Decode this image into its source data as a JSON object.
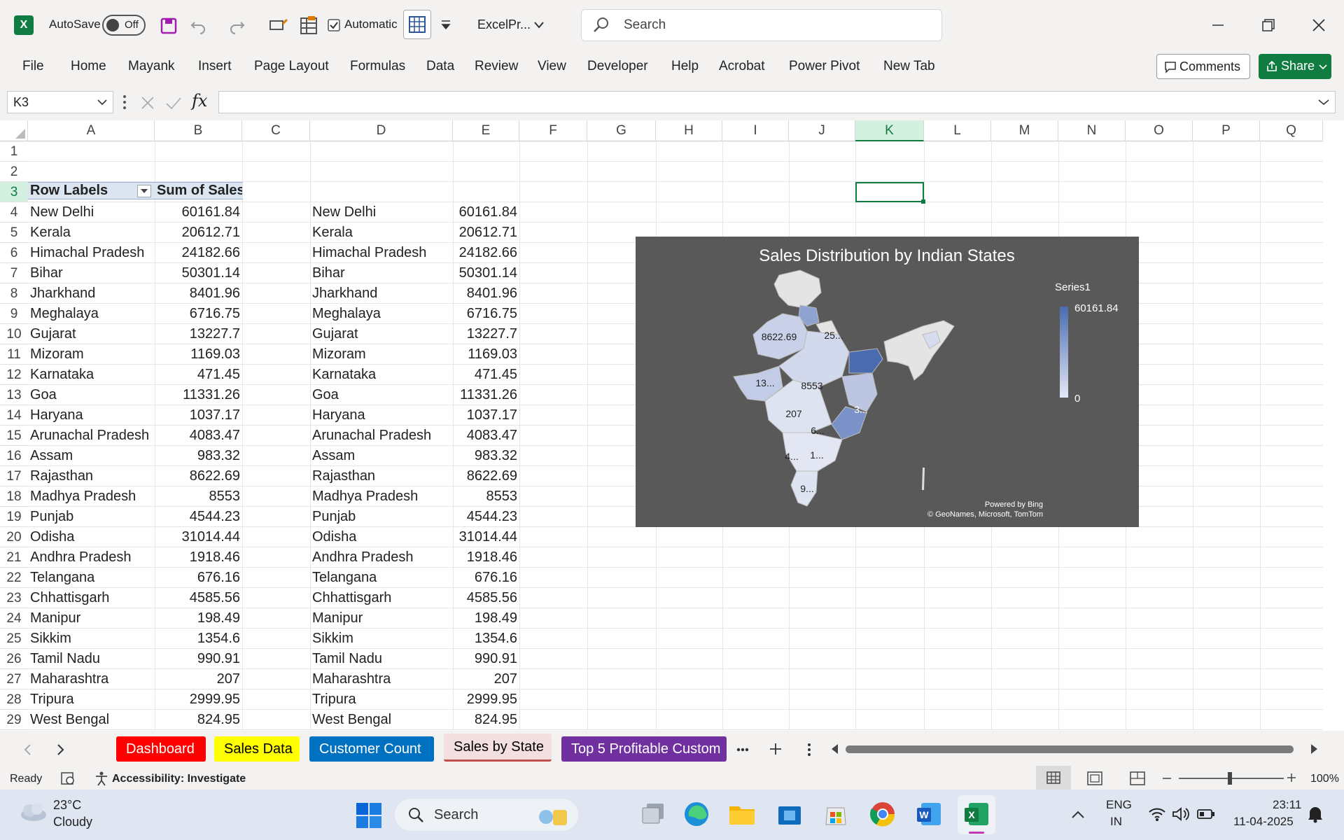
{
  "titlebar": {
    "autosave_label": "AutoSave",
    "autosave_state": "Off",
    "calc_mode": "Automatic",
    "filename": "ExcelPr...",
    "search_placeholder": "Search"
  },
  "ribbon": {
    "tabs": [
      "File",
      "Home",
      "Mayank",
      "Insert",
      "Page Layout",
      "Formulas",
      "Data",
      "Review",
      "View",
      "Developer",
      "Help",
      "Acrobat",
      "Power Pivot",
      "New Tab"
    ],
    "comments_label": "Comments",
    "share_label": "Share"
  },
  "formula_bar": {
    "name_box": "K3",
    "fx": "fx",
    "formula": ""
  },
  "columns": [
    "A",
    "B",
    "C",
    "D",
    "E",
    "F",
    "G",
    "H",
    "I",
    "J",
    "K",
    "L",
    "M",
    "N",
    "O",
    "P",
    "Q"
  ],
  "rows": [
    "1",
    "2",
    "3",
    "4",
    "5",
    "6",
    "7",
    "8",
    "9",
    "10",
    "11",
    "12",
    "13",
    "14",
    "15",
    "16",
    "17",
    "18",
    "19",
    "20",
    "21",
    "22",
    "23",
    "24",
    "25",
    "26",
    "27",
    "28",
    "29"
  ],
  "pivot": {
    "header_labels": "Row Labels",
    "header_sum": "Sum of Sales",
    "rows": [
      [
        "New Delhi",
        "60161.84"
      ],
      [
        "Kerala",
        "20612.71"
      ],
      [
        "Himachal Pradesh",
        "24182.66"
      ],
      [
        "Bihar",
        "50301.14"
      ],
      [
        "Jharkhand",
        "8401.96"
      ],
      [
        "Meghalaya",
        "6716.75"
      ],
      [
        "Gujarat",
        "13227.7"
      ],
      [
        "Mizoram",
        "1169.03"
      ],
      [
        "Karnataka",
        "471.45"
      ],
      [
        "Goa",
        "11331.26"
      ],
      [
        "Haryana",
        "1037.17"
      ],
      [
        "Arunachal Pradesh",
        "4083.47"
      ],
      [
        "Assam",
        "983.32"
      ],
      [
        "Rajasthan",
        "8622.69"
      ],
      [
        "Madhya Pradesh",
        "8553"
      ],
      [
        "Punjab",
        "4544.23"
      ],
      [
        "Odisha",
        "31014.44"
      ],
      [
        "Andhra Pradesh",
        "1918.46"
      ],
      [
        "Telangana",
        "676.16"
      ],
      [
        "Chhattisgarh",
        "4585.56"
      ],
      [
        "Manipur",
        "198.49"
      ],
      [
        "Sikkim",
        "1354.6"
      ],
      [
        "Tamil Nadu",
        "990.91"
      ],
      [
        "Maharashtra",
        "207"
      ],
      [
        "Tripura",
        "2999.95"
      ],
      [
        "West Bengal",
        "824.95"
      ]
    ]
  },
  "chart": {
    "title": "Sales Distribution by Indian States",
    "legend_title": "Series1",
    "legend_max": "60161.84",
    "legend_min": "0",
    "credit_line1": "Powered by Bing",
    "credit_line2": "© GeoNames, Microsoft, TomTom",
    "map_labels": [
      "8622.69",
      "25...",
      "13...",
      "8553",
      "207",
      "3...",
      "6...",
      "4...",
      "1...",
      "9..."
    ],
    "colors": {
      "background": "#595959",
      "dark": "#4a6bb0",
      "light": "#dde3f1"
    }
  },
  "sheet_tabs": [
    {
      "label": "Dashboard",
      "bg": "#ff0000",
      "fg": "#ffffff"
    },
    {
      "label": "Sales Data",
      "bg": "#ffff00",
      "fg": "#000000"
    },
    {
      "label": "Customer Count",
      "bg": "#0070c0",
      "fg": "#ffffff"
    },
    {
      "label": "Sales by State",
      "bg": "#f4dfe0",
      "fg": "#000000"
    },
    {
      "label": "Top 5 Profitable Custom",
      "bg": "#7030a0",
      "fg": "#ffffff"
    }
  ],
  "status": {
    "ready": "Ready",
    "accessibility": "Accessibility: Investigate",
    "zoom": "100%"
  },
  "taskbar": {
    "temp": "23°C",
    "weather": "Cloudy",
    "search": "Search",
    "lang1": "ENG",
    "lang2": "IN",
    "time": "23:11",
    "date": "11-04-2025"
  }
}
